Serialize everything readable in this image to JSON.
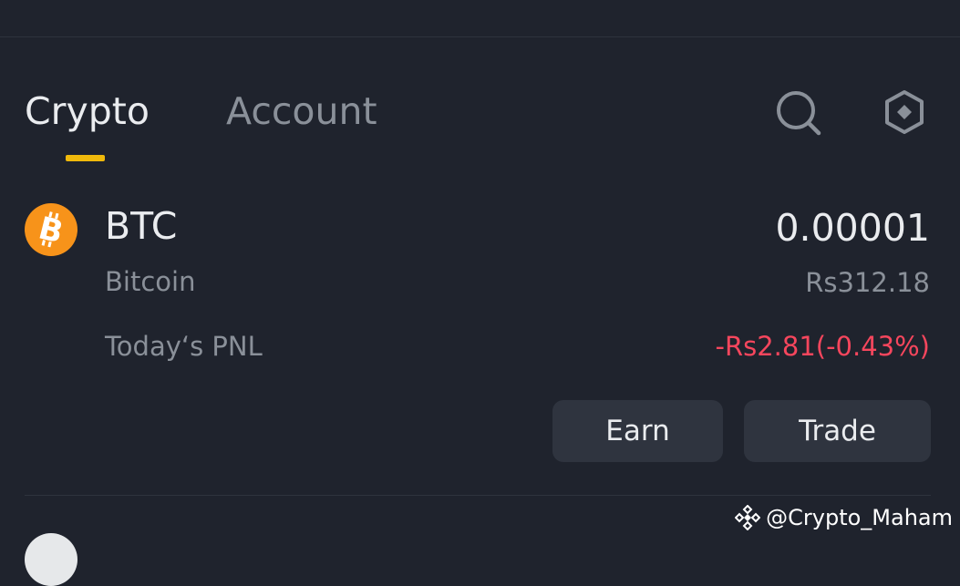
{
  "tabs": [
    {
      "label": "Crypto",
      "active": true
    },
    {
      "label": "Account",
      "active": false
    }
  ],
  "header_icons": {
    "search": "search-icon",
    "settings": "hexagon-settings-icon"
  },
  "asset": {
    "symbol": "BTC",
    "name": "Bitcoin",
    "icon": "bitcoin-icon",
    "balance": "0.00001",
    "fiat_value": "Rs312.18",
    "pnl_label": "Today‘s PNL",
    "pnl_value": "-Rs2.81(-0.43%)",
    "pnl_color": "#f6465d"
  },
  "actions": {
    "earn_label": "Earn",
    "trade_label": "Trade"
  },
  "watermark": {
    "text": "@Crypto_Maham",
    "icon": "binance-diamond-icon"
  },
  "colors": {
    "background": "#1f232d",
    "accent": "#f0b90b",
    "bitcoin": "#f7931a",
    "button_bg": "#2f343f",
    "muted_text": "#8a9099"
  }
}
